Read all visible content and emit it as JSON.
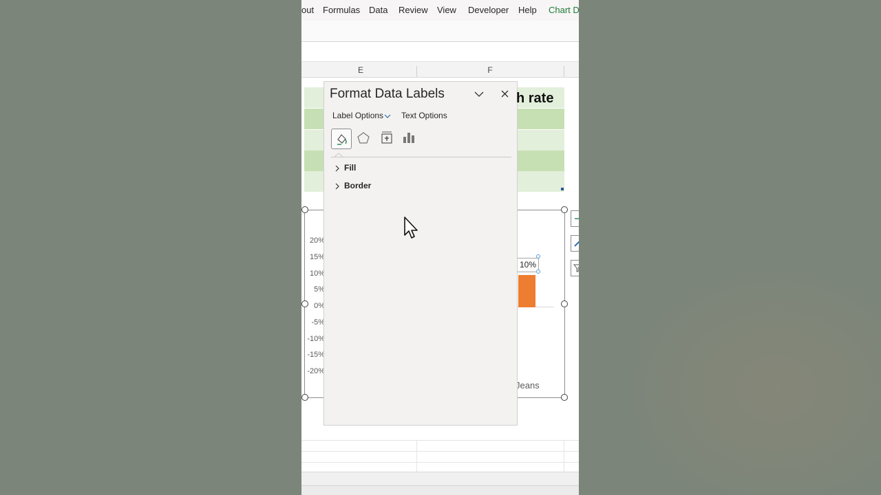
{
  "ribbon": {
    "tabs": [
      "out",
      "Formulas",
      "Data",
      "Review",
      "View",
      "Developer",
      "Help",
      "Chart De"
    ],
    "accent_tab_index": 7,
    "accent_color": "#1f7a3b"
  },
  "sheet": {
    "columns": [
      "E",
      "F"
    ],
    "header_text": "h rate",
    "band_colors": {
      "light": "#e2efda",
      "dark": "#c6e0b4"
    }
  },
  "chart": {
    "y_ticks": [
      "20%",
      "15%",
      "10%",
      "5%",
      "0%",
      "-5%",
      "-10%",
      "-15%",
      "-20%"
    ],
    "category_label": "Jeans",
    "bar_color": "#ed7d31"
  },
  "chart_data": {
    "type": "bar",
    "categories": [
      "Jeans"
    ],
    "values": [
      0.1
    ],
    "ylim": [
      -0.2,
      0.2
    ],
    "yticks": [
      0.2,
      0.15,
      0.1,
      0.05,
      0.0,
      -0.05,
      -0.1,
      -0.15,
      -0.2
    ],
    "data_labels": [
      "10%"
    ],
    "grid": false
  },
  "pane": {
    "title": "Format Data Labels",
    "tabs": {
      "label_options": "Label Options",
      "text_options": "Text Options"
    },
    "category_icons": [
      "fill-line-icon",
      "effects-icon",
      "size-properties-icon",
      "label-options-icon"
    ],
    "sections": [
      "Fill",
      "Border"
    ]
  }
}
